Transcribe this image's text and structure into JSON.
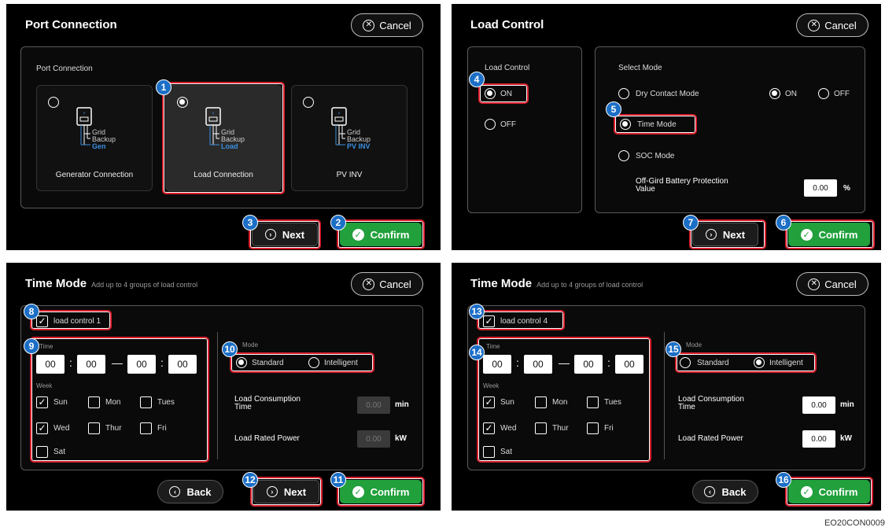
{
  "common": {
    "cancel_label": "Cancel",
    "next_label": "Next",
    "confirm_label": "Confirm",
    "back_label": "Back",
    "time_value": "00",
    "dash": "—"
  },
  "port_connection": {
    "title": "Port Connection",
    "box_label": "Port Connection",
    "cards": [
      {
        "label": "Generator Connection",
        "icon_line1": "Grid",
        "icon_line2": "Backup",
        "icon_line3": "Gen",
        "selected": false
      },
      {
        "label": "Load Connection",
        "icon_line1": "Grid",
        "icon_line2": "Backup",
        "icon_line3": "Load",
        "selected": true
      },
      {
        "label": "PV INV",
        "icon_line1": "Grid",
        "icon_line2": "Backup",
        "icon_line3": "PV INV",
        "selected": false
      }
    ]
  },
  "load_control": {
    "title": "Load Control",
    "left_label": "Load Control",
    "on_label": "ON",
    "off_label": "OFF",
    "select_mode_label": "Select Mode",
    "dry_contact_label": "Dry Contact Mode",
    "dry_on_label": "ON",
    "dry_off_label": "OFF",
    "time_mode_label": "Time Mode",
    "soc_mode_label": "SOC Mode",
    "protection_line1": "Off-Gird Battery Protection",
    "protection_line2": "Value",
    "protection_value": "0.00",
    "protection_unit": "%"
  },
  "time_mode": {
    "title": "Time Mode",
    "subtitle": "Add up to 4 groups of load control",
    "time_label": "Time",
    "week_label": "Week",
    "mode_label": "Mode",
    "standard_label": "Standard",
    "intelligent_label": "Intelligent",
    "consumption_line1": "Load Consumption",
    "consumption_line2": "Time",
    "rated_power_label": "Load Rated Power",
    "value": "0.00",
    "min_unit": "min",
    "kw_unit": "kW",
    "days": [
      "Sun",
      "Mon",
      "Tues",
      "Wed",
      "Thur",
      "Fri",
      "Sat"
    ],
    "control1_label": "load control 1",
    "control4_label": "load control 4"
  },
  "checked_days": [
    "Sun",
    "Wed"
  ],
  "badges": [
    "1",
    "2",
    "3",
    "4",
    "5",
    "6",
    "7",
    "8",
    "9",
    "10",
    "11",
    "12",
    "13",
    "14",
    "15",
    "16"
  ],
  "footer_ref": "EO20CON0009",
  "colors": {
    "confirm_green": "#21a03c",
    "highlight_red": "#d81e2c",
    "badge_blue": "#1c6fc6"
  }
}
